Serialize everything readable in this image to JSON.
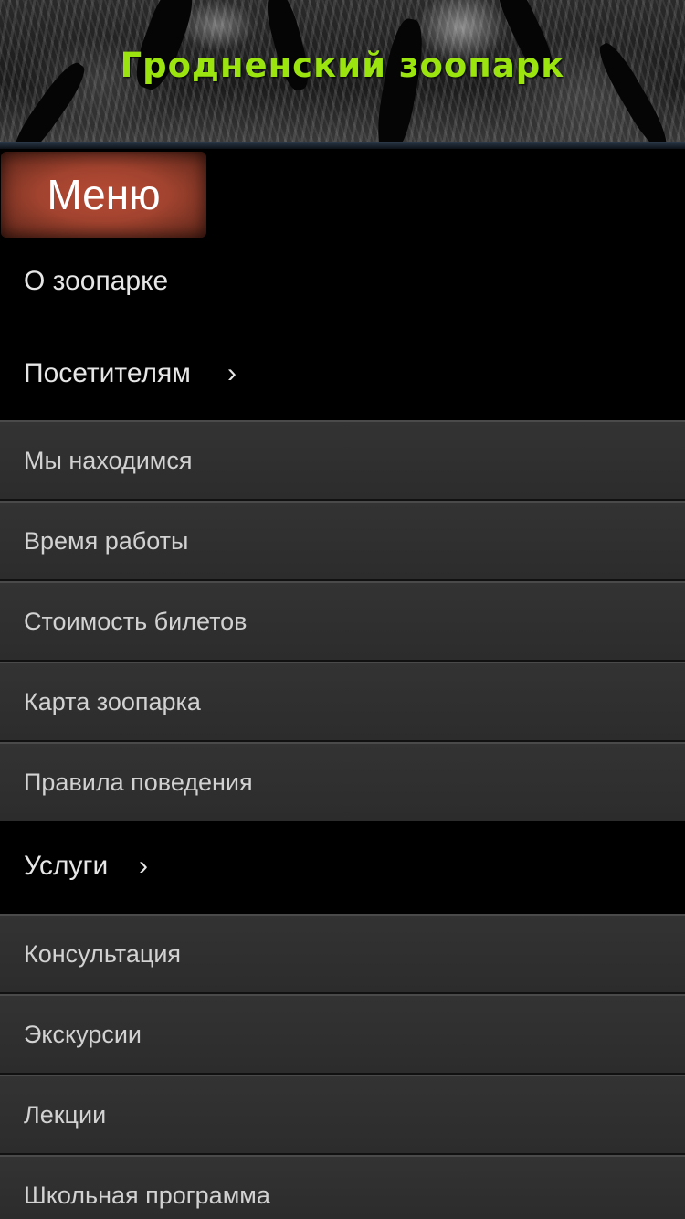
{
  "header": {
    "title": "Гродненский зоопарк"
  },
  "menu": {
    "toggle_label": "Меню",
    "sections": [
      {
        "label": "О зоопарке",
        "has_children": false
      },
      {
        "label": "Посетителям",
        "has_children": true,
        "chevron": "›",
        "items": [
          "Мы находимся",
          "Время работы",
          "Стоимость билетов",
          "Карта зоопарка",
          "Правила поведения"
        ]
      },
      {
        "label": "Услуги",
        "has_children": true,
        "chevron": "›",
        "items": [
          "Консультация",
          "Экскурсии",
          "Лекции",
          "Школьная программа"
        ]
      }
    ]
  },
  "colors": {
    "title": "#9be40f",
    "menu_button": "#a1432f",
    "sub_item_bg": "#303030"
  }
}
